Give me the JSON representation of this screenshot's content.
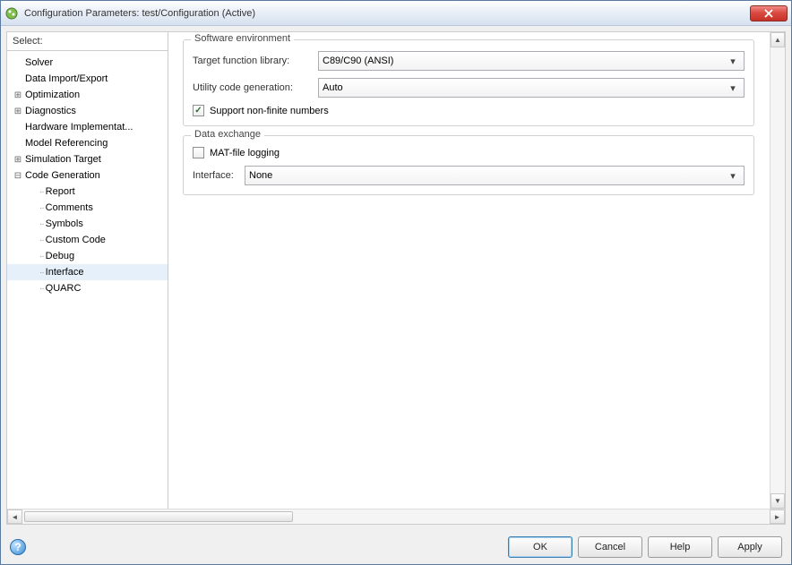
{
  "window": {
    "title": "Configuration Parameters: test/Configuration (Active)"
  },
  "sidebar": {
    "header": "Select:",
    "items": [
      {
        "label": "Solver",
        "level": 0,
        "expandable": false
      },
      {
        "label": "Data Import/Export",
        "level": 0,
        "expandable": false
      },
      {
        "label": "Optimization",
        "level": 0,
        "expandable": true,
        "expanded": false
      },
      {
        "label": "Diagnostics",
        "level": 0,
        "expandable": true,
        "expanded": false
      },
      {
        "label": "Hardware Implementat...",
        "level": 0,
        "expandable": false
      },
      {
        "label": "Model Referencing",
        "level": 0,
        "expandable": false
      },
      {
        "label": "Simulation Target",
        "level": 0,
        "expandable": true,
        "expanded": false
      },
      {
        "label": "Code Generation",
        "level": 0,
        "expandable": true,
        "expanded": true
      },
      {
        "label": "Report",
        "level": 1,
        "expandable": false
      },
      {
        "label": "Comments",
        "level": 1,
        "expandable": false
      },
      {
        "label": "Symbols",
        "level": 1,
        "expandable": false
      },
      {
        "label": "Custom Code",
        "level": 1,
        "expandable": false
      },
      {
        "label": "Debug",
        "level": 1,
        "expandable": false
      },
      {
        "label": "Interface",
        "level": 1,
        "expandable": false,
        "selected": true
      },
      {
        "label": "QUARC",
        "level": 1,
        "expandable": false
      }
    ]
  },
  "panel": {
    "group_software": {
      "title": "Software environment",
      "target_lib_label": "Target function library:",
      "target_lib_value": "C89/C90 (ANSI)",
      "utility_label": "Utility code generation:",
      "utility_value": "Auto",
      "support_nonfinite_label": "Support non-finite numbers",
      "support_nonfinite_checked": true
    },
    "group_data": {
      "title": "Data exchange",
      "matfile_label": "MAT-file logging",
      "matfile_checked": false,
      "interface_label": "Interface:",
      "interface_value": "None"
    }
  },
  "footer": {
    "ok": "OK",
    "cancel": "Cancel",
    "help": "Help",
    "apply": "Apply"
  }
}
